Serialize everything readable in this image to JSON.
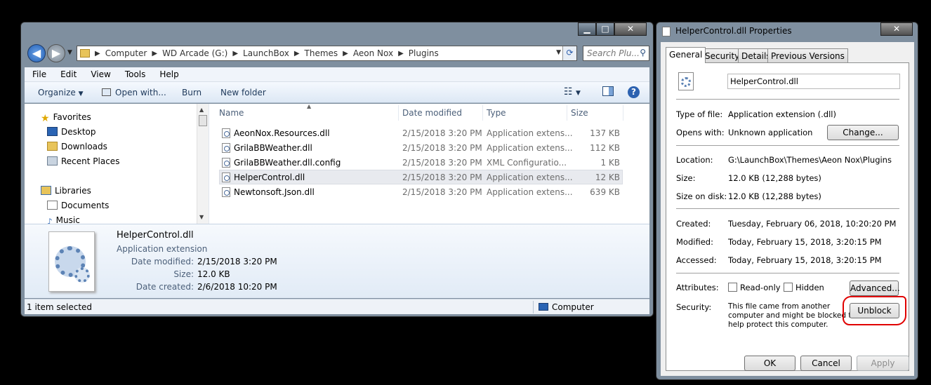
{
  "explorer": {
    "address_segments": [
      "Computer",
      "WD Arcade (G:)",
      "LaunchBox",
      "Themes",
      "Aeon Nox",
      "Plugins"
    ],
    "search_placeholder": "Search Plu...",
    "menu": [
      "File",
      "Edit",
      "View",
      "Tools",
      "Help"
    ],
    "toolbar": {
      "organize": "Organize",
      "open_with": "Open with...",
      "burn": "Burn",
      "new_folder": "New folder"
    },
    "nav": {
      "favorites": "Favorites",
      "desktop": "Desktop",
      "downloads": "Downloads",
      "recent_places": "Recent Places",
      "libraries": "Libraries",
      "documents": "Documents",
      "music": "Music"
    },
    "columns": {
      "name": "Name",
      "date_modified": "Date modified",
      "type": "Type",
      "size": "Size"
    },
    "files": [
      {
        "name": "AeonNox.Resources.dll",
        "date": "2/15/2018 3:20 PM",
        "type": "Application extens...",
        "size": "137 KB"
      },
      {
        "name": "GrilaBBWeather.dll",
        "date": "2/15/2018 3:20 PM",
        "type": "Application extens...",
        "size": "112 KB"
      },
      {
        "name": "GrilaBBWeather.dll.config",
        "date": "2/15/2018 3:20 PM",
        "type": "XML Configuratio...",
        "size": "1 KB"
      },
      {
        "name": "HelperControl.dll",
        "date": "2/15/2018 3:20 PM",
        "type": "Application extens...",
        "size": "12 KB"
      },
      {
        "name": "Newtonsoft.Json.dll",
        "date": "2/15/2018 3:20 PM",
        "type": "Application extens...",
        "size": "639 KB"
      }
    ],
    "details": {
      "name": "HelperControl.dll",
      "kind": "Application extension",
      "date_modified_label": "Date modified:",
      "date_modified": "2/15/2018 3:20 PM",
      "size_label": "Size:",
      "size": "12.0 KB",
      "date_created_label": "Date created:",
      "date_created": "2/6/2018 10:20 PM"
    },
    "status": {
      "selected": "1 item selected",
      "location": "Computer"
    }
  },
  "props": {
    "title": "HelperControl.dll Properties",
    "tabs": [
      "General",
      "Security",
      "Details",
      "Previous Versions"
    ],
    "filename": "HelperControl.dll",
    "type_label": "Type of file:",
    "type_value": "Application extension (.dll)",
    "opens_label": "Opens with:",
    "opens_value": "Unknown application",
    "change_btn": "Change...",
    "location_label": "Location:",
    "location_value": "G:\\LaunchBox\\Themes\\Aeon Nox\\Plugins",
    "size_label": "Size:",
    "size_value": "12.0 KB (12,288 bytes)",
    "sizedisk_label": "Size on disk:",
    "sizedisk_value": "12.0 KB (12,288 bytes)",
    "created_label": "Created:",
    "created_value": "Tuesday, February 06, 2018, 10:20:20 PM",
    "modified_label": "Modified:",
    "modified_value": "Today, February 15, 2018, 3:20:15 PM",
    "accessed_label": "Accessed:",
    "accessed_value": "Today, February 15, 2018, 3:20:15 PM",
    "attributes_label": "Attributes:",
    "readonly_label": "Read-only",
    "hidden_label": "Hidden",
    "advanced_btn": "Advanced...",
    "security_label": "Security:",
    "security_line1": "This file came from another",
    "security_line2": "computer and might be blocked to",
    "security_line3": "help protect this computer.",
    "unblock_btn": "Unblock",
    "ok_btn": "OK",
    "cancel_btn": "Cancel",
    "apply_btn": "Apply"
  },
  "colors": {
    "highlight_circle": "#e00000",
    "window_frame": "#7f8f9f"
  }
}
